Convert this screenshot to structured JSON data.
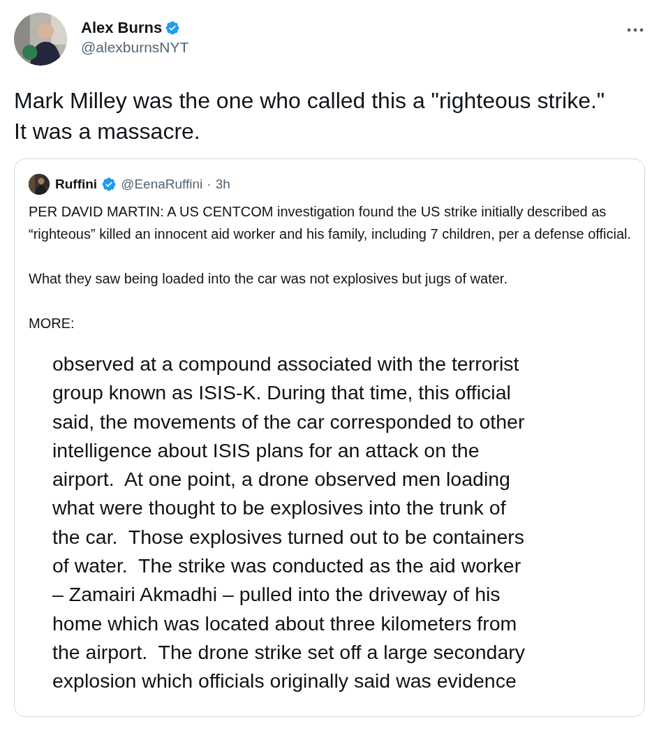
{
  "author": {
    "name": "Alex Burns",
    "verified": true,
    "handle": "@alexburnsNYT"
  },
  "tweet_text": "Mark Milley was the one who called this a \"righteous strike.\" It was a massacre.",
  "quoted_tweet": {
    "name": "Ruffini",
    "verified": true,
    "handle": "@EenaRuffini",
    "separator": "·",
    "time": "3h",
    "paragraphs": [
      "PER DAVID MARTIN: A US CENTCOM investigation found the US strike initially described as “righteous” killed an innocent aid worker and his family, including 7 children, per a defense official.",
      "What they saw being loaded into the car was not explosives but jugs of water.",
      "MORE:"
    ],
    "document_lines": [
      "observed at a compound associated with the terrorist",
      "group known as ISIS-K. During that time, this official",
      "said, the movements of the car corresponded to other",
      "intelligence about ISIS plans for an attack on the",
      "airport.  At one point, a drone observed men loading",
      "what were thought to be explosives into the trunk of",
      "the car.  Those explosives turned out to be containers",
      "of water.  The strike was conducted as the aid worker",
      "– Zamairi Akmadhi – pulled into the driveway of his",
      "home which was located about three kilometers from",
      "the airport.  The drone strike set off a large secondary",
      "explosion which officials originally said was evidence"
    ]
  }
}
